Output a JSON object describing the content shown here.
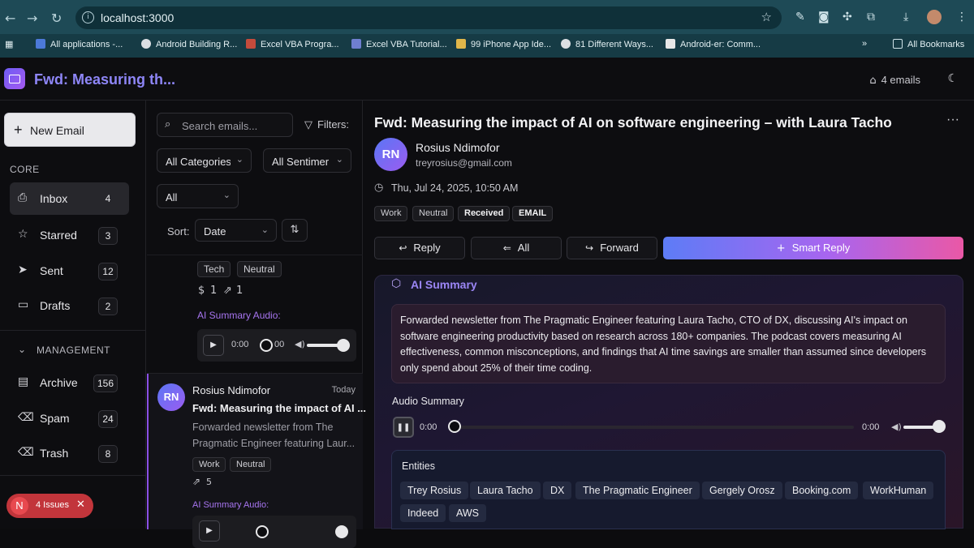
{
  "browser": {
    "url": "localhost:3000",
    "bookmarks": [
      "All applications -...",
      "Android Building R...",
      "Excel VBA Progra...",
      "Excel VBA Tutorial...",
      "99 iPhone App Ide...",
      "81 Different Ways...",
      "Android-er: Comm..."
    ],
    "more_bookmarks": "»",
    "all_bookmarks": "All Bookmarks"
  },
  "app": {
    "title": "Fwd: Measuring th...",
    "email_count": "4 emails"
  },
  "sidebar": {
    "new_email": "New Email",
    "core_label": "CORE",
    "core_items": [
      {
        "label": "Inbox",
        "count": "4"
      },
      {
        "label": "Starred",
        "count": "3"
      },
      {
        "label": "Sent",
        "count": "12"
      },
      {
        "label": "Drafts",
        "count": "2"
      }
    ],
    "management_label": "MANAGEMENT",
    "management_items": [
      {
        "label": "Archive",
        "count": "156"
      },
      {
        "label": "Spam",
        "count": "24"
      },
      {
        "label": "Trash",
        "count": "8"
      }
    ],
    "issues": {
      "badge": "N",
      "label": "4 Issues"
    }
  },
  "list": {
    "search_placeholder": "Search emails...",
    "filters_label": "Filters:",
    "category_select": "All Categories",
    "sentiment_select": "All Sentimer",
    "all_select": "All",
    "sort_label": "Sort:",
    "sort_select": "Date",
    "prev_item": {
      "tags": [
        "Tech",
        "Neutral"
      ],
      "stat_money": "1",
      "stat_share": "1",
      "audio_label": "AI Summary Audio:",
      "time_current": "0:00",
      "time_total": "00"
    },
    "item": {
      "initials": "RN",
      "sender": "Rosius Ndimofor",
      "date": "Today",
      "subject": "Fwd: Measuring the impact of AI ...",
      "preview_line1": "Forwarded newsletter from The",
      "preview_line2": "Pragmatic Engineer featuring Laur...",
      "tags": [
        "Work",
        "Neutral"
      ],
      "share_count": "5",
      "audio_label": "AI Summary Audio:"
    }
  },
  "reader": {
    "subject": "Fwd: Measuring the impact of AI on software engineering – with Laura Tacho",
    "more": "···",
    "initials": "RN",
    "sender_name": "Rosius Ndimofor",
    "sender_email": "treyrosius@gmail.com",
    "date": "Thu, Jul 24, 2025, 10:50 AM",
    "tags": [
      "Work",
      "Neutral",
      "Received",
      "EMAIL"
    ],
    "actions": {
      "reply": "Reply",
      "reply_all": "All",
      "forward": "Forward",
      "smart_reply": "Smart Reply"
    },
    "ai_summary": {
      "heading": "AI Summary",
      "text": "Forwarded newsletter from The Pragmatic Engineer featuring Laura Tacho, CTO of DX, discussing AI's impact on software engineering productivity based on research across 180+ companies. The podcast covers measuring AI effectiveness, common misconceptions, and findings that AI time savings are smaller than assumed since developers only spend about 25% of their time coding.",
      "audio_label": "Audio Summary",
      "time_current": "0:00",
      "time_total": "0:00"
    },
    "entities": {
      "heading": "Entities",
      "items": [
        "Trey Rosius",
        "Laura Tacho",
        "DX",
        "The Pragmatic Engineer",
        "Gergely Orosz",
        "Booking.com",
        "WorkHuman",
        "Indeed",
        "AWS"
      ]
    }
  },
  "colors": {
    "accent": "#8e86f7",
    "smart_reply_start": "#5d7cf6",
    "smart_reply_end": "#ea58a6",
    "issues": "#c2353b"
  }
}
